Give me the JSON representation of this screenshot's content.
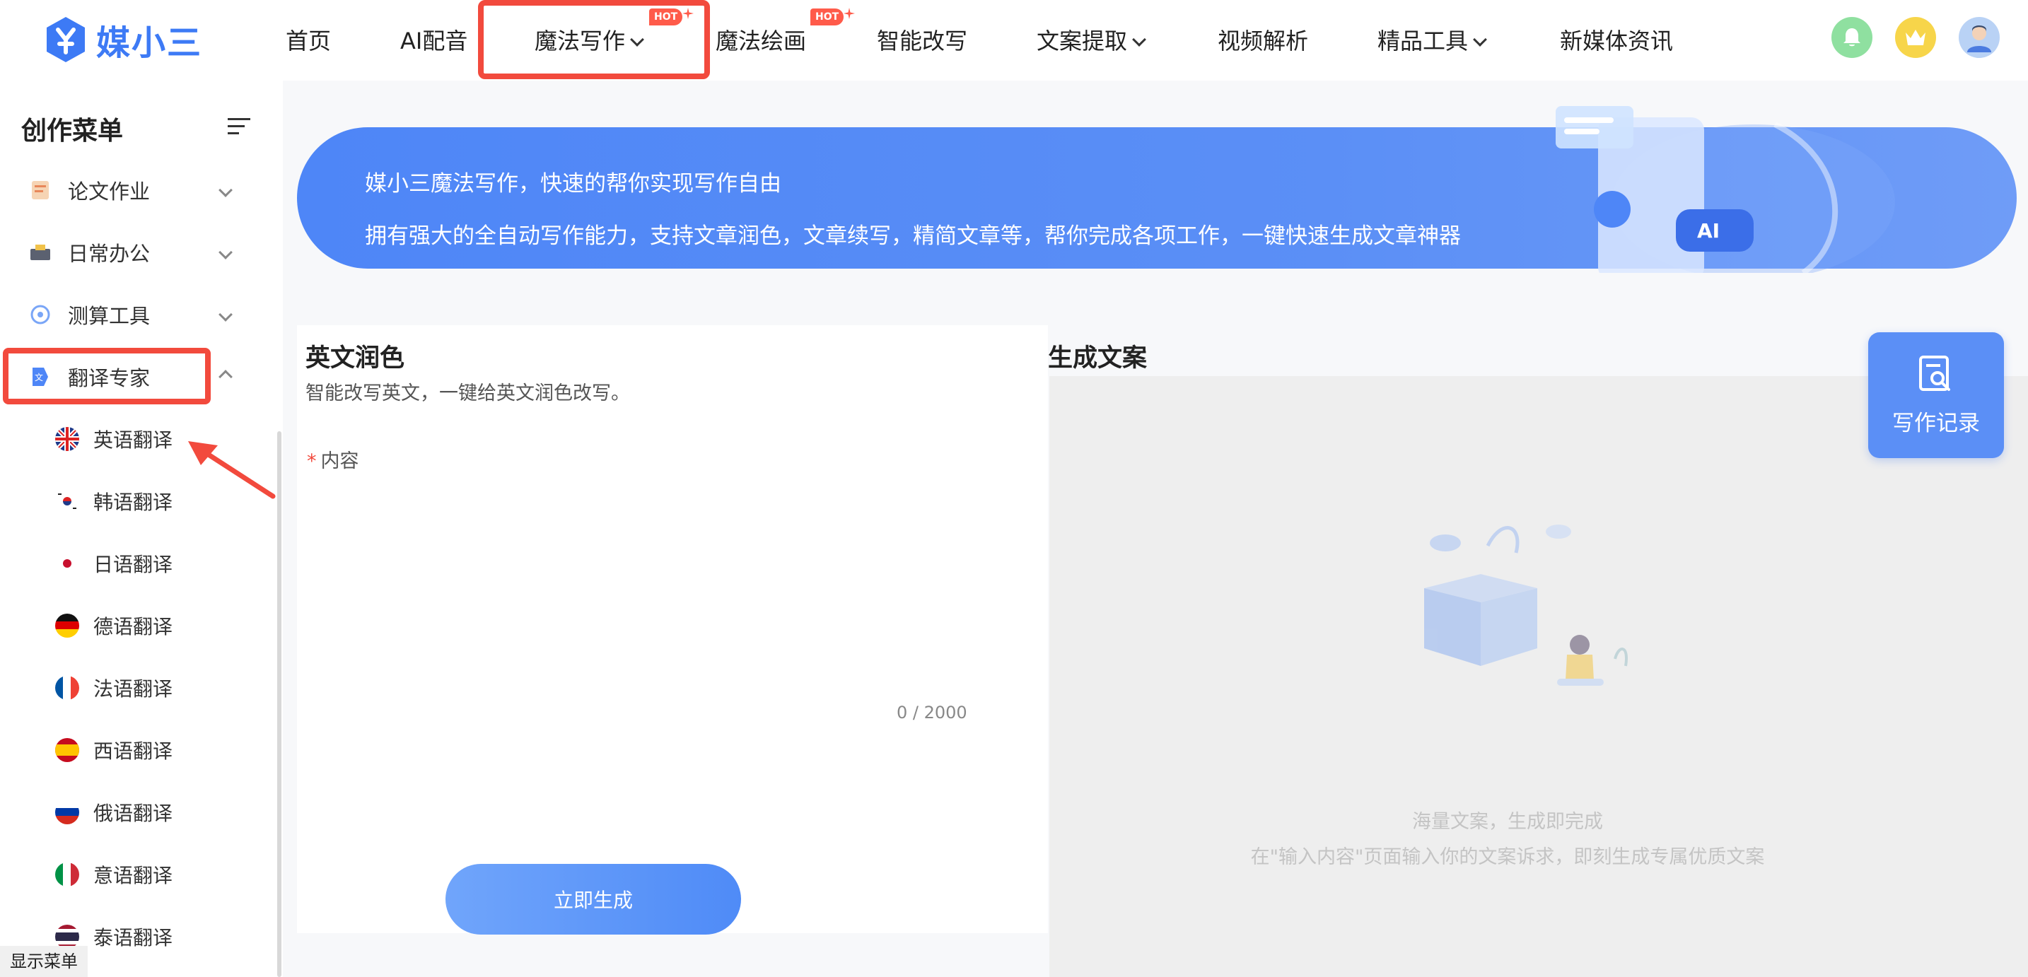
{
  "brand": {
    "name": "媒小三",
    "accent": "#3d7af5"
  },
  "nav": {
    "items": [
      {
        "label": "首页",
        "dropdown": false,
        "hot": false
      },
      {
        "label": "AI配音",
        "dropdown": false,
        "hot": false
      },
      {
        "label": "魔法写作",
        "dropdown": true,
        "hot": true
      },
      {
        "label": "魔法绘画",
        "dropdown": false,
        "hot": true
      },
      {
        "label": "智能改写",
        "dropdown": false,
        "hot": false
      },
      {
        "label": "文案提取",
        "dropdown": true,
        "hot": false
      },
      {
        "label": "视频解析",
        "dropdown": false,
        "hot": false
      },
      {
        "label": "精品工具",
        "dropdown": true,
        "hot": false
      },
      {
        "label": "新媒体资讯",
        "dropdown": false,
        "hot": false
      }
    ],
    "hot_badge": "HOT",
    "icons": [
      "bell-icon",
      "crown-icon",
      "avatar"
    ]
  },
  "sidebar": {
    "title": "创作菜单",
    "groups": [
      {
        "label": "论文作业",
        "icon": "paper-icon",
        "expanded": false
      },
      {
        "label": "日常办公",
        "icon": "office-icon",
        "expanded": false
      },
      {
        "label": "测算工具",
        "icon": "calc-icon",
        "expanded": false
      },
      {
        "label": "翻译专家",
        "icon": "translate-icon",
        "expanded": true
      }
    ],
    "sub_items": [
      {
        "label": "英语翻译",
        "flag": "uk-flag-icon"
      },
      {
        "label": "韩语翻译",
        "flag": "kr-flag-icon"
      },
      {
        "label": "日语翻译",
        "flag": "jp-flag-icon"
      },
      {
        "label": "德语翻译",
        "flag": "de-flag-icon"
      },
      {
        "label": "法语翻译",
        "flag": "fr-flag-icon"
      },
      {
        "label": "西语翻译",
        "flag": "es-flag-icon"
      },
      {
        "label": "俄语翻译",
        "flag": "ru-flag-icon"
      },
      {
        "label": "意语翻译",
        "flag": "it-flag-icon"
      },
      {
        "label": "泰语翻译",
        "flag": "th-flag-icon"
      }
    ],
    "show_menu": "显示菜单"
  },
  "banner": {
    "line1": "媒小三魔法写作，快速的帮你实现写作自由",
    "line2": "拥有强大的全自动写作能力，支持文章润色，文章续写，精简文章等，帮你完成各项工作，一键快速生成文章神器"
  },
  "form": {
    "title": "英文润色",
    "description": "智能改写英文，一键给英文润色改写。",
    "required_mark": "*",
    "content_label": "内容",
    "content_value": "",
    "counter": "0 / 2000",
    "generate_label": "立即生成"
  },
  "output": {
    "title": "生成文案",
    "empty_line1": "海量文案，生成即完成",
    "empty_line2": "在\"输入内容\"页面输入你的文案诉求，即刻生成专属优质文案"
  },
  "record_button": {
    "label": "写作记录"
  },
  "colors": {
    "highlight": "#f24a3d",
    "banner": "#4e86f7",
    "button": "#5b8ff6"
  }
}
